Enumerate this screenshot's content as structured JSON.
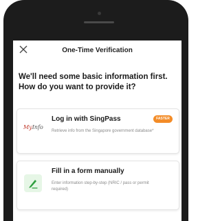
{
  "dialog": {
    "title": "One-Time Verification",
    "heading": "We'll need some basic information first. How do you want to provide it?"
  },
  "options": [
    {
      "logo_main": "My",
      "logo_tail": "Info",
      "title": "Log in with SingPass",
      "badge": "FASTER",
      "description": "Retrieve info from the Singapore government database*"
    },
    {
      "title": "Fill in a form manually",
      "description": "Enter information step-by-step (NRIC / pass or permit required)"
    }
  ],
  "colors": {
    "badge": "#f38c28",
    "logo": "#c0392b",
    "pencil": "#2e9e3e"
  }
}
